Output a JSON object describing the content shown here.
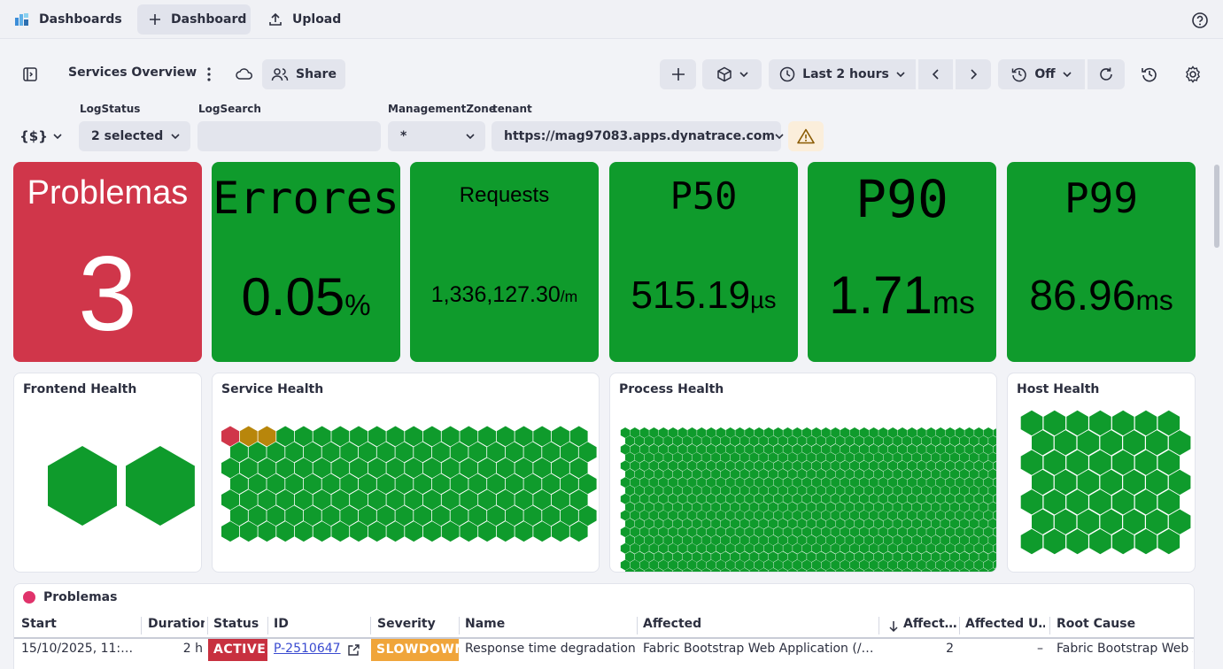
{
  "topbar": {
    "dashboards_label": "Dashboards",
    "new_dashboard_label": "Dashboard",
    "upload_label": "Upload"
  },
  "header": {
    "title": "Services Overview",
    "share_label": "Share",
    "timeframe_label": "Last 2 hours",
    "refresh_label": "Off"
  },
  "filters": {
    "variables_label": "{$}",
    "logstatus": {
      "label": "LogStatus",
      "value": "2 selected"
    },
    "logsearch": {
      "label": "LogSearch",
      "value": ""
    },
    "mz": {
      "label": "ManagementZone",
      "value": "*"
    },
    "tenant": {
      "label": "tenant",
      "value": "https://mag97083.apps.dynatrace.com"
    }
  },
  "tiles": [
    {
      "name": "Problemas",
      "value": "3",
      "unit": "",
      "color": "#d0364a"
    },
    {
      "name": "Errores",
      "value": "0.05",
      "unit": "%",
      "color": "#0f9b2c"
    },
    {
      "name": "Requests",
      "value": "1,336,127.30",
      "unit": "/m",
      "color": "#0f9b2c"
    },
    {
      "name": "P50",
      "value": "515.19",
      "unit": "µs",
      "color": "#0f9b2c"
    },
    {
      "name": "P90",
      "value": "1.71",
      "unit": "ms",
      "color": "#0f9b2c"
    },
    {
      "name": "P99",
      "value": "86.96",
      "unit": "ms",
      "color": "#0f9b2c"
    }
  ],
  "health": {
    "frontend_title": "Frontend Health",
    "service_title": "Service Health",
    "process_title": "Process Health",
    "host_title": "Host Health",
    "colors": {
      "healthy": "#0f9b2c",
      "critical": "#d0364a",
      "warning": "#b8860b"
    }
  },
  "problems": {
    "title": "Problemas",
    "columns": [
      "Start",
      "Duration",
      "Status",
      "ID",
      "Severity",
      "Name",
      "Affected",
      "Affect…",
      "Affected U…",
      "Root Cause"
    ],
    "row": {
      "start": "15/10/2025, 11:…",
      "duration": "2 h",
      "status": "ACTIVE",
      "id": "P-2510647",
      "severity": "SLOWDOWN",
      "name": "Response time degradation",
      "affected": "Fabric Bootstrap Web Application (/…",
      "affected_count": "2",
      "affected_users": "–",
      "root_cause": "Fabric Bootstrap Web A"
    }
  }
}
